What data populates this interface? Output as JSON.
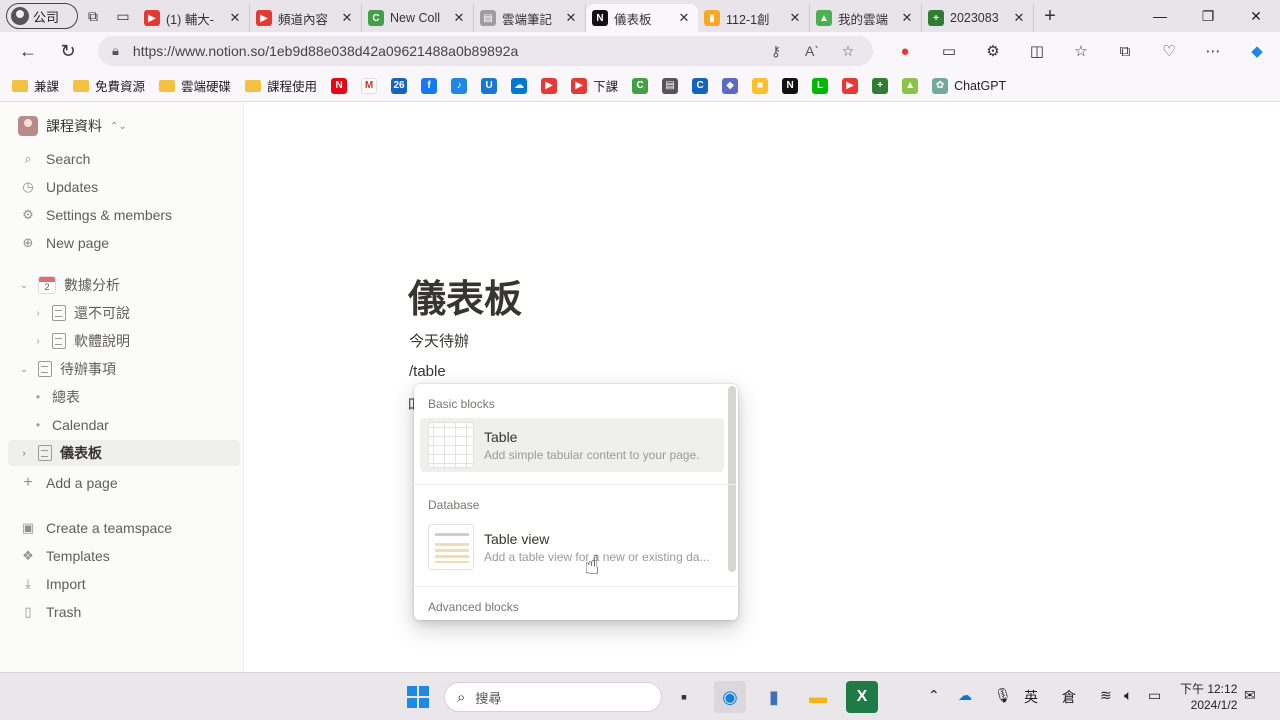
{
  "browser": {
    "profile_label": "公司",
    "tabs": [
      {
        "title": "(1) 輔大-",
        "fav_color": "#e53935",
        "fav_glyph": "▶"
      },
      {
        "title": "頻道內容",
        "fav_color": "#e53935",
        "fav_glyph": "▶"
      },
      {
        "title": "New Coll",
        "fav_color": "#43a047",
        "fav_glyph": "C"
      },
      {
        "title": "雲端筆記",
        "fav_color": "#9e9e9e",
        "fav_glyph": "▤"
      },
      {
        "title": "儀表板",
        "fav_color": "#111111",
        "fav_glyph": "N"
      },
      {
        "title": "112-1創",
        "fav_color": "#f9a825",
        "fav_glyph": "▮"
      },
      {
        "title": "我的雲端",
        "fav_color": "#4caf50",
        "fav_glyph": "▲"
      },
      {
        "title": "2023083",
        "fav_color": "#2e7d32",
        "fav_glyph": "+"
      }
    ],
    "url": "https://www.notion.so/1eb9d88e038d42a09621488a0b89892a",
    "bookmarks": [
      {
        "label": "兼課",
        "type": "folder"
      },
      {
        "label": "免費資源",
        "type": "folder"
      },
      {
        "label": "雲端硬碟",
        "type": "folder"
      },
      {
        "label": "課程使用",
        "type": "folder"
      },
      {
        "label": "",
        "type": "icon",
        "color": "#e50914",
        "glyph": "N"
      },
      {
        "label": "",
        "type": "icon",
        "color": "#ffffff",
        "glyph": "M"
      },
      {
        "label": "",
        "type": "icon",
        "color": "#1565c0",
        "glyph": "26"
      },
      {
        "label": "",
        "type": "icon",
        "color": "#1877f2",
        "glyph": "f"
      },
      {
        "label": "",
        "type": "icon",
        "color": "#1e88e5",
        "glyph": "♪"
      },
      {
        "label": "",
        "type": "icon",
        "color": "#1976d2",
        "glyph": "U"
      },
      {
        "label": "",
        "type": "icon",
        "color": "#0078d4",
        "glyph": "☁"
      },
      {
        "label": "",
        "type": "icon",
        "color": "#e53935",
        "glyph": "▶"
      },
      {
        "label": "下課",
        "type": "icon",
        "color": "#e53935",
        "glyph": "▶"
      },
      {
        "label": "",
        "type": "icon",
        "color": "#43a047",
        "glyph": "C"
      },
      {
        "label": "",
        "type": "icon",
        "color": "#555555",
        "glyph": "▤"
      },
      {
        "label": "",
        "type": "icon",
        "color": "#1565c0",
        "glyph": "C"
      },
      {
        "label": "",
        "type": "icon",
        "color": "#5c6bc0",
        "glyph": "◆"
      },
      {
        "label": "",
        "type": "icon",
        "color": "#fbc02d",
        "glyph": "■"
      },
      {
        "label": "",
        "type": "icon",
        "color": "#111111",
        "glyph": "N"
      },
      {
        "label": "",
        "type": "icon",
        "color": "#00b900",
        "glyph": "L"
      },
      {
        "label": "",
        "type": "icon",
        "color": "#e53935",
        "glyph": "▶"
      },
      {
        "label": "",
        "type": "icon",
        "color": "#2e7d32",
        "glyph": "+"
      },
      {
        "label": "",
        "type": "icon",
        "color": "#8bc34a",
        "glyph": "▲"
      },
      {
        "label": "ChatGPT",
        "type": "icon",
        "color": "#74aa9c",
        "glyph": "✿"
      }
    ]
  },
  "sidebar": {
    "workspace": "課程資料",
    "top_items": [
      {
        "label": "Search",
        "icon": "search-icon"
      },
      {
        "label": "Updates",
        "icon": "clock-icon"
      },
      {
        "label": "Settings & members",
        "icon": "gear-icon"
      },
      {
        "label": "New page",
        "icon": "plus-circle-icon"
      }
    ],
    "tree": [
      {
        "label": "數據分析",
        "level": 0,
        "kind": "calendar",
        "chevron": "open",
        "cal_num": "2"
      },
      {
        "label": "還不可說",
        "level": 1,
        "kind": "page",
        "chevron": "closed"
      },
      {
        "label": "軟體說明",
        "level": 1,
        "kind": "page",
        "chevron": "closed"
      },
      {
        "label": "待辦事項",
        "level": 0,
        "kind": "page",
        "chevron": "open"
      },
      {
        "label": "總表",
        "level": 1,
        "kind": "dot"
      },
      {
        "label": "Calendar",
        "level": 1,
        "kind": "dot"
      },
      {
        "label": "儀表板",
        "level": 0,
        "kind": "page",
        "chevron": "closed",
        "selected": true
      }
    ],
    "add_page": "Add a page",
    "bottom_items": [
      {
        "label": "Create a teamspace",
        "icon": "teamspace-icon"
      },
      {
        "label": "Templates",
        "icon": "templates-icon"
      },
      {
        "label": "Import",
        "icon": "import-icon"
      },
      {
        "label": "Trash",
        "icon": "trash-icon"
      }
    ]
  },
  "page": {
    "title": "儀表板",
    "line1": "今天待辦",
    "line2": "/table",
    "partial_glyph": "吅"
  },
  "slash_menu": {
    "section1": "Basic blocks",
    "opt1_name": "Table",
    "opt1_desc": "Add simple tabular content to your page.",
    "section2": "Database",
    "opt2_name": "Table view",
    "opt2_desc": "Add a table view for a new or existing da...",
    "section3": "Advanced blocks"
  },
  "taskbar": {
    "search_placeholder": "搜尋",
    "ime1": "英",
    "ime2": "倉",
    "time": "下午 12:12",
    "date": "2024/1/2"
  }
}
